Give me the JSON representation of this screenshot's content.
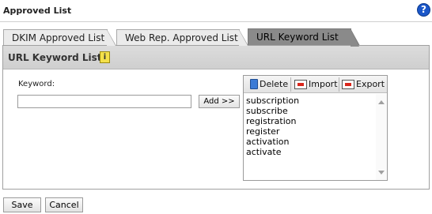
{
  "window": {
    "title": "Approved List",
    "help_icon": "help-icon"
  },
  "tabs": [
    {
      "label": "DKIM Approved List",
      "active": false
    },
    {
      "label": "Web Rep. Approved List",
      "active": false
    },
    {
      "label": "URL Keyword List",
      "active": true
    }
  ],
  "panel": {
    "title": "URL Keyword List",
    "info_icon": "info-icon"
  },
  "keyword": {
    "label": "Keyword:",
    "value": "",
    "placeholder": "",
    "add_label": "Add >>"
  },
  "list": {
    "toolbar": {
      "delete_label": "Delete",
      "import_label": "Import",
      "export_label": "Export"
    },
    "items": [
      "subscription",
      "subscribe",
      "registration",
      "register",
      "activation",
      "activate"
    ]
  },
  "footer": {
    "save_label": "Save",
    "cancel_label": "Cancel"
  },
  "colors": {
    "active_tab": "#8a8a8a",
    "help_icon": "#1b57c9",
    "info_icon": "#f4e04a",
    "action_icon": "#d9261c"
  }
}
